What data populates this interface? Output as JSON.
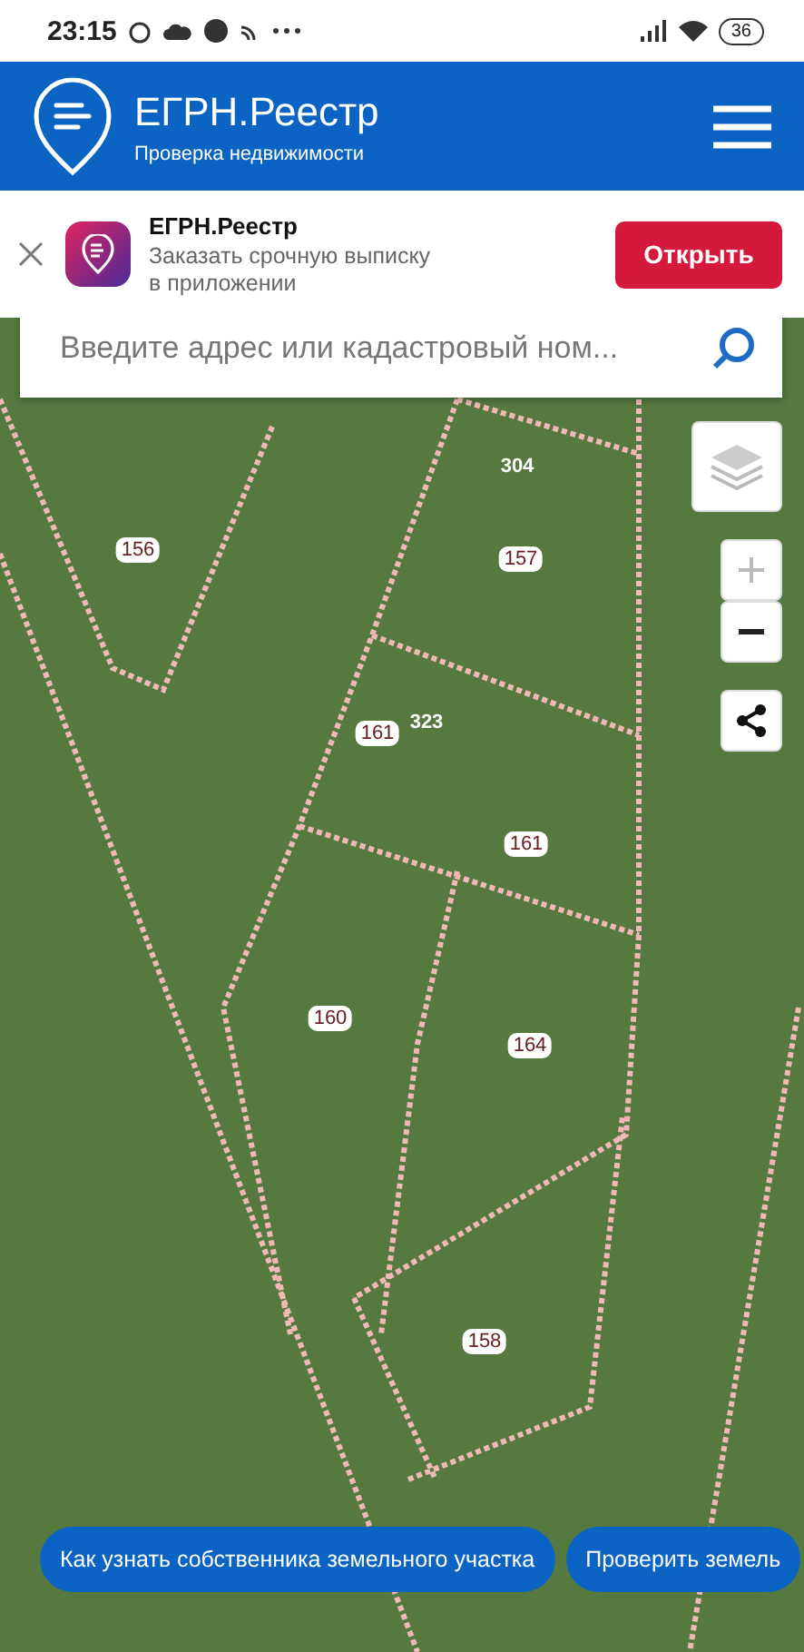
{
  "status_bar": {
    "time": "23:15",
    "battery": "36"
  },
  "header": {
    "title": "ЕГРН.Реестр",
    "subtitle": "Проверка недвижимости"
  },
  "app_banner": {
    "title": "ЕГРН.Реестр",
    "text": "Заказать срочную выписку в приложении",
    "button": "Открыть"
  },
  "search": {
    "placeholder": "Введите адрес или кадастровый ном..."
  },
  "map": {
    "labels": [
      {
        "text": "304",
        "kind": "building"
      },
      {
        "text": "156",
        "kind": "parcel"
      },
      {
        "text": "157",
        "kind": "parcel"
      },
      {
        "text": "323",
        "kind": "building"
      },
      {
        "text": "161",
        "kind": "parcel"
      },
      {
        "text": "161",
        "kind": "parcel"
      },
      {
        "text": "160",
        "kind": "parcel"
      },
      {
        "text": "164",
        "kind": "parcel"
      },
      {
        "text": "158",
        "kind": "parcel"
      }
    ]
  },
  "chips": [
    "Как узнать собственника земельного участка",
    "Проверить земель"
  ]
}
